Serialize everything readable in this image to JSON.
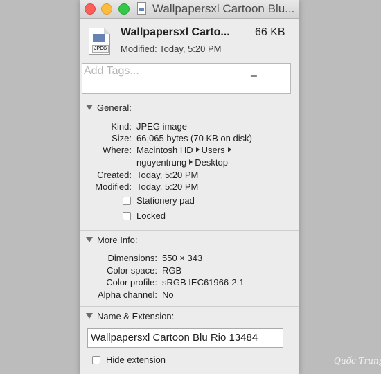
{
  "window": {
    "title": "Wallpapersxl Cartoon Blu..."
  },
  "header": {
    "file_name": "Wallpapersxl Carto...",
    "file_size": "66 KB",
    "modified": "Modified: Today, 5:20 PM",
    "icon_badge": "JPEG"
  },
  "tags": {
    "placeholder": "Add Tags..."
  },
  "general": {
    "heading": "General:",
    "rows": [
      {
        "label": "Kind:",
        "value": "JPEG image"
      },
      {
        "label": "Size:",
        "value": "66,065 bytes (70 KB on disk)"
      },
      {
        "label": "Where:",
        "value": "Macintosh HD"
      },
      {
        "label": "Created:",
        "value": "Today, 5:20 PM"
      },
      {
        "label": "Modified:",
        "value": "Today, 5:20 PM"
      }
    ],
    "where_parts": [
      "Users",
      "nguyentrung",
      "Desktop"
    ],
    "stationery_label": "Stationery pad",
    "locked_label": "Locked"
  },
  "more_info": {
    "heading": "More Info:",
    "rows": [
      {
        "label": "Dimensions:",
        "value": "550 × 343"
      },
      {
        "label": "Color space:",
        "value": "RGB"
      },
      {
        "label": "Color profile:",
        "value": "sRGB IEC61966-2.1"
      },
      {
        "label": "Alpha channel:",
        "value": "No"
      }
    ]
  },
  "name_extension": {
    "heading": "Name & Extension:",
    "value": "Wallpapersxl Cartoon Blu Rio 13484",
    "hide_extension_label": "Hide extension"
  },
  "watermark": "Quốc Trung",
  "colors": {
    "desktop": "#bdbcbd",
    "window_bg": "#ececec",
    "close": "#fc605b",
    "minimize": "#fdbc40",
    "maximize": "#34c84a"
  },
  "icons": [
    "close-icon",
    "minimize-icon",
    "maximize-icon",
    "jpeg-file-icon",
    "disclosure-triangle-icon",
    "path-arrow-icon",
    "text-cursor-icon"
  ]
}
